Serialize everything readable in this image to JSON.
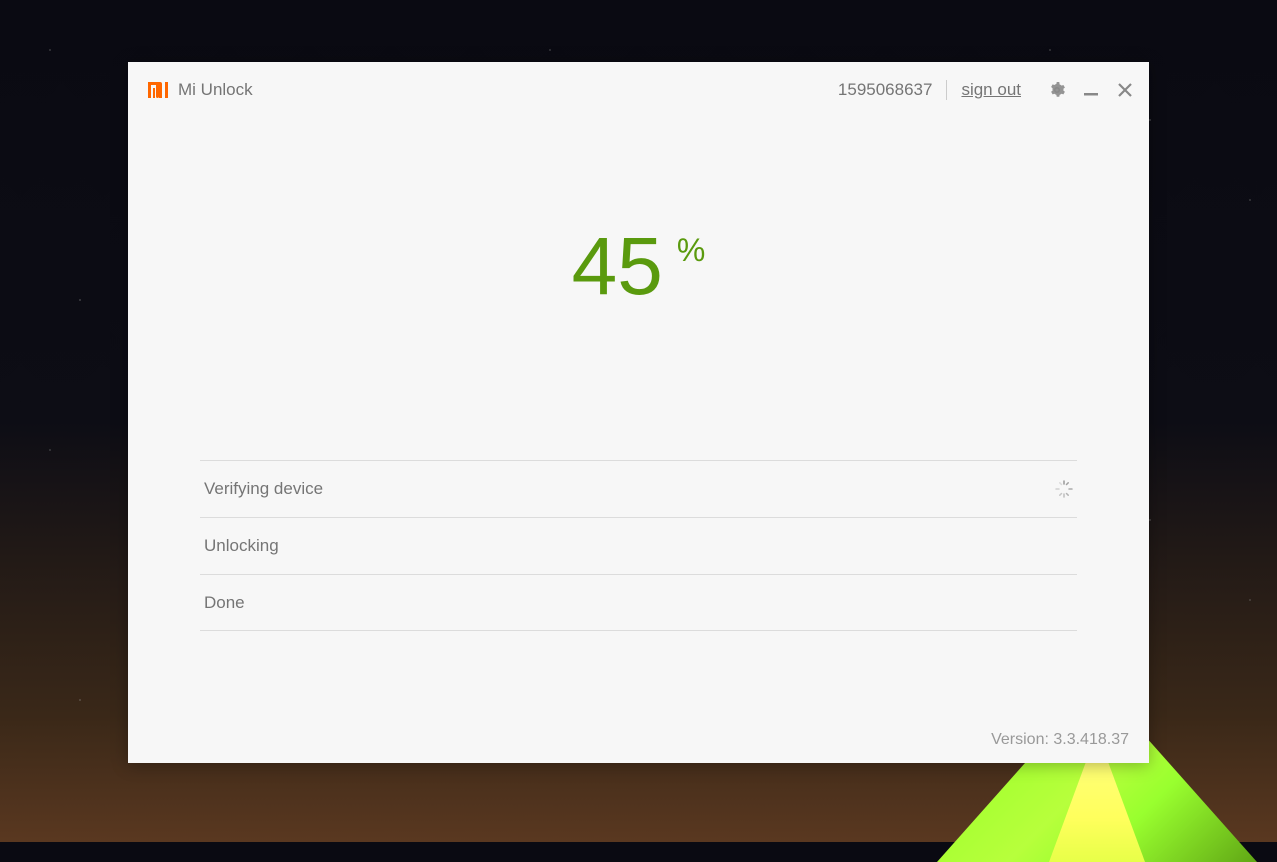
{
  "header": {
    "app_title": "Mi Unlock",
    "account_id": "1595068637",
    "sign_out_label": "sign out"
  },
  "progress": {
    "value": "45",
    "unit": "%"
  },
  "steps": [
    {
      "label": "Verifying device",
      "spinning": true
    },
    {
      "label": "Unlocking",
      "spinning": false
    },
    {
      "label": "Done",
      "spinning": false
    }
  ],
  "footer": {
    "version_label": "Version: 3.3.418.37"
  }
}
